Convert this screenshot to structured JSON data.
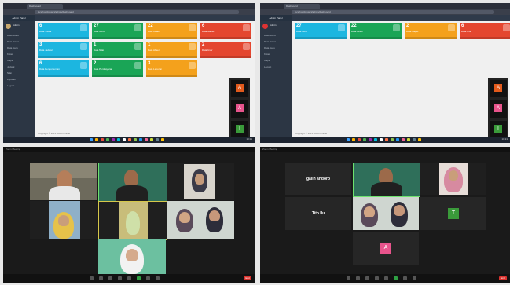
{
  "browser": {
    "tab_title": "Dashboard",
    "url": "localhost/project/admin/dashboard"
  },
  "dashboard_left": {
    "brand": "Admin Panel",
    "user_name": "Admin",
    "menu": [
      "Dashboard",
      "Data Siswa",
      "Data Guru",
      "Kelas",
      "Mapel",
      "Jadwal",
      "Nilai",
      "Laporan",
      "Logout"
    ],
    "tiles": [
      {
        "value": "6",
        "label": "Data Siswa",
        "color": "#1cb6e0"
      },
      {
        "value": "27",
        "label": "Data Guru",
        "color": "#1aa556"
      },
      {
        "value": "22",
        "label": "Data Kelas",
        "color": "#f4a11c"
      },
      {
        "value": "6",
        "label": "Data Mapel",
        "color": "#e4462f"
      },
      {
        "value": "3",
        "label": "Data Jadwal",
        "color": "#1cb6e0"
      },
      {
        "value": "1",
        "label": "Data Nilai",
        "color": "#1aa556"
      },
      {
        "value": "1",
        "label": "Data Absen",
        "color": "#f4a11c"
      },
      {
        "value": "2",
        "label": "Data User",
        "color": "#e4462f"
      },
      {
        "value": "6",
        "label": "Data Pengumuman",
        "color": "#1cb6e0"
      },
      {
        "value": "2",
        "label": "Data Pembayaran",
        "color": "#1aa556"
      },
      {
        "value": "3",
        "label": "Data Laporan",
        "color": "#f4a11c"
      }
    ],
    "footer": "Copyright © 2021 Admin Panel"
  },
  "dashboard_right": {
    "brand": "Admin Panel",
    "user_name": "Admin",
    "menu": [
      "Dashboard",
      "Data Siswa",
      "Data Guru",
      "Kelas",
      "Mapel",
      "Logout"
    ],
    "tiles": [
      {
        "value": "27",
        "label": "Data Guru",
        "color": "#1cb6e0"
      },
      {
        "value": "22",
        "label": "Data Kelas",
        "color": "#1aa556"
      },
      {
        "value": "2",
        "label": "Data Mapel",
        "color": "#f4a11c"
      },
      {
        "value": "6",
        "label": "Data User",
        "color": "#e4462f"
      }
    ],
    "footer": "Copyright © 2021 Admin Panel"
  },
  "strip_letters": [
    "A",
    "A",
    "T"
  ],
  "strip_colors": [
    "#e25a1c",
    "#e8548c",
    "#3a9a3a"
  ],
  "taskbar": {
    "clock": "10:21"
  },
  "zoom_left": {
    "window_title": "Zoom Meeting",
    "end_label": "End",
    "participants": []
  },
  "zoom_right": {
    "window_title": "Zoom Meeting",
    "end_label": "End",
    "name_tiles": [
      "galih andoro",
      "Tito Ilu"
    ],
    "letters": [
      "T",
      "A"
    ]
  }
}
